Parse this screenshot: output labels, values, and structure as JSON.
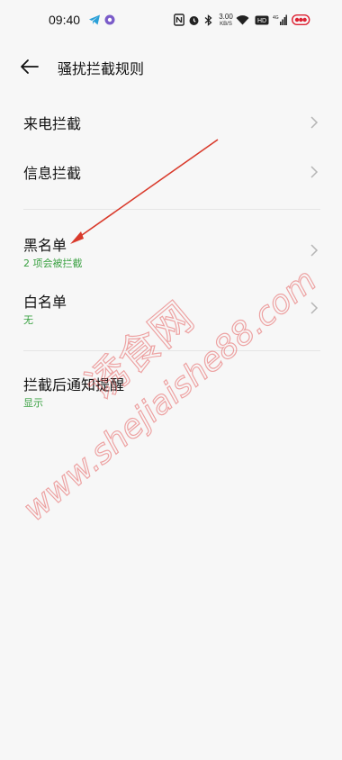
{
  "status_bar": {
    "time": "09:40",
    "net_speed_value": "3.00",
    "net_speed_unit": "KB/S",
    "icons": [
      "telegram-icon",
      "app-icon",
      "nfc-icon",
      "alarm-icon",
      "bluetooth-icon",
      "wifi-icon",
      "hd-icon",
      "signal-icon",
      "battery-icon"
    ]
  },
  "header": {
    "title": "骚扰拦截规则"
  },
  "rows": {
    "incoming_call": {
      "label": "来电拦截"
    },
    "message": {
      "label": "信息拦截"
    },
    "blacklist": {
      "label": "黑名单",
      "sub": "2 项会被拦截"
    },
    "whitelist": {
      "label": "白名单",
      "sub": "无"
    },
    "notify": {
      "label": "拦截后通知提醒",
      "sub": "显示"
    }
  },
  "colors": {
    "accent_green": "#3aa142",
    "watermark_red": "#e45050",
    "annotation_red": "#d93a2b"
  },
  "watermark": {
    "text_cn": "诱食网",
    "text_url": "www.shejiaishe88.com"
  }
}
